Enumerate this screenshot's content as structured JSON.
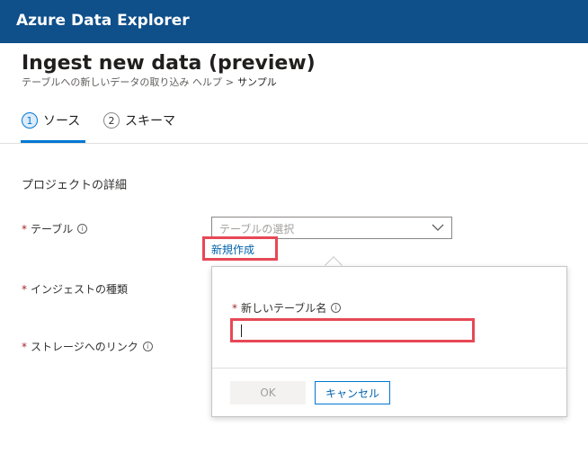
{
  "app": {
    "title": "Azure Data Explorer"
  },
  "page": {
    "title": "Ingest new data (preview)",
    "breadcrumb": {
      "link": "テーブルへの新しいデータの取り込み ヘルプ",
      "separator": ">",
      "current": "サンプル"
    }
  },
  "tabs": [
    {
      "number": "1",
      "label": "ソース",
      "active": true
    },
    {
      "number": "2",
      "label": "スキーマ",
      "active": false
    }
  ],
  "form": {
    "section_title": "プロジェクトの詳細",
    "required_marker": "*",
    "info_glyph": "i",
    "table": {
      "label": "テーブル",
      "placeholder": "テーブルの選択",
      "create_link": "新規作成"
    },
    "ingestion_type": {
      "label": "インジェストの種類"
    },
    "storage_link": {
      "label": "ストレージへのリンク"
    }
  },
  "popup": {
    "name_label": "新しいテーブル名",
    "name_value": "",
    "ok_label": "OK",
    "cancel_label": "キャンセル"
  },
  "colors": {
    "header_bg": "#0f4f8a",
    "accent": "#0078d4",
    "highlight": "#e74856",
    "required": "#a4262c"
  }
}
